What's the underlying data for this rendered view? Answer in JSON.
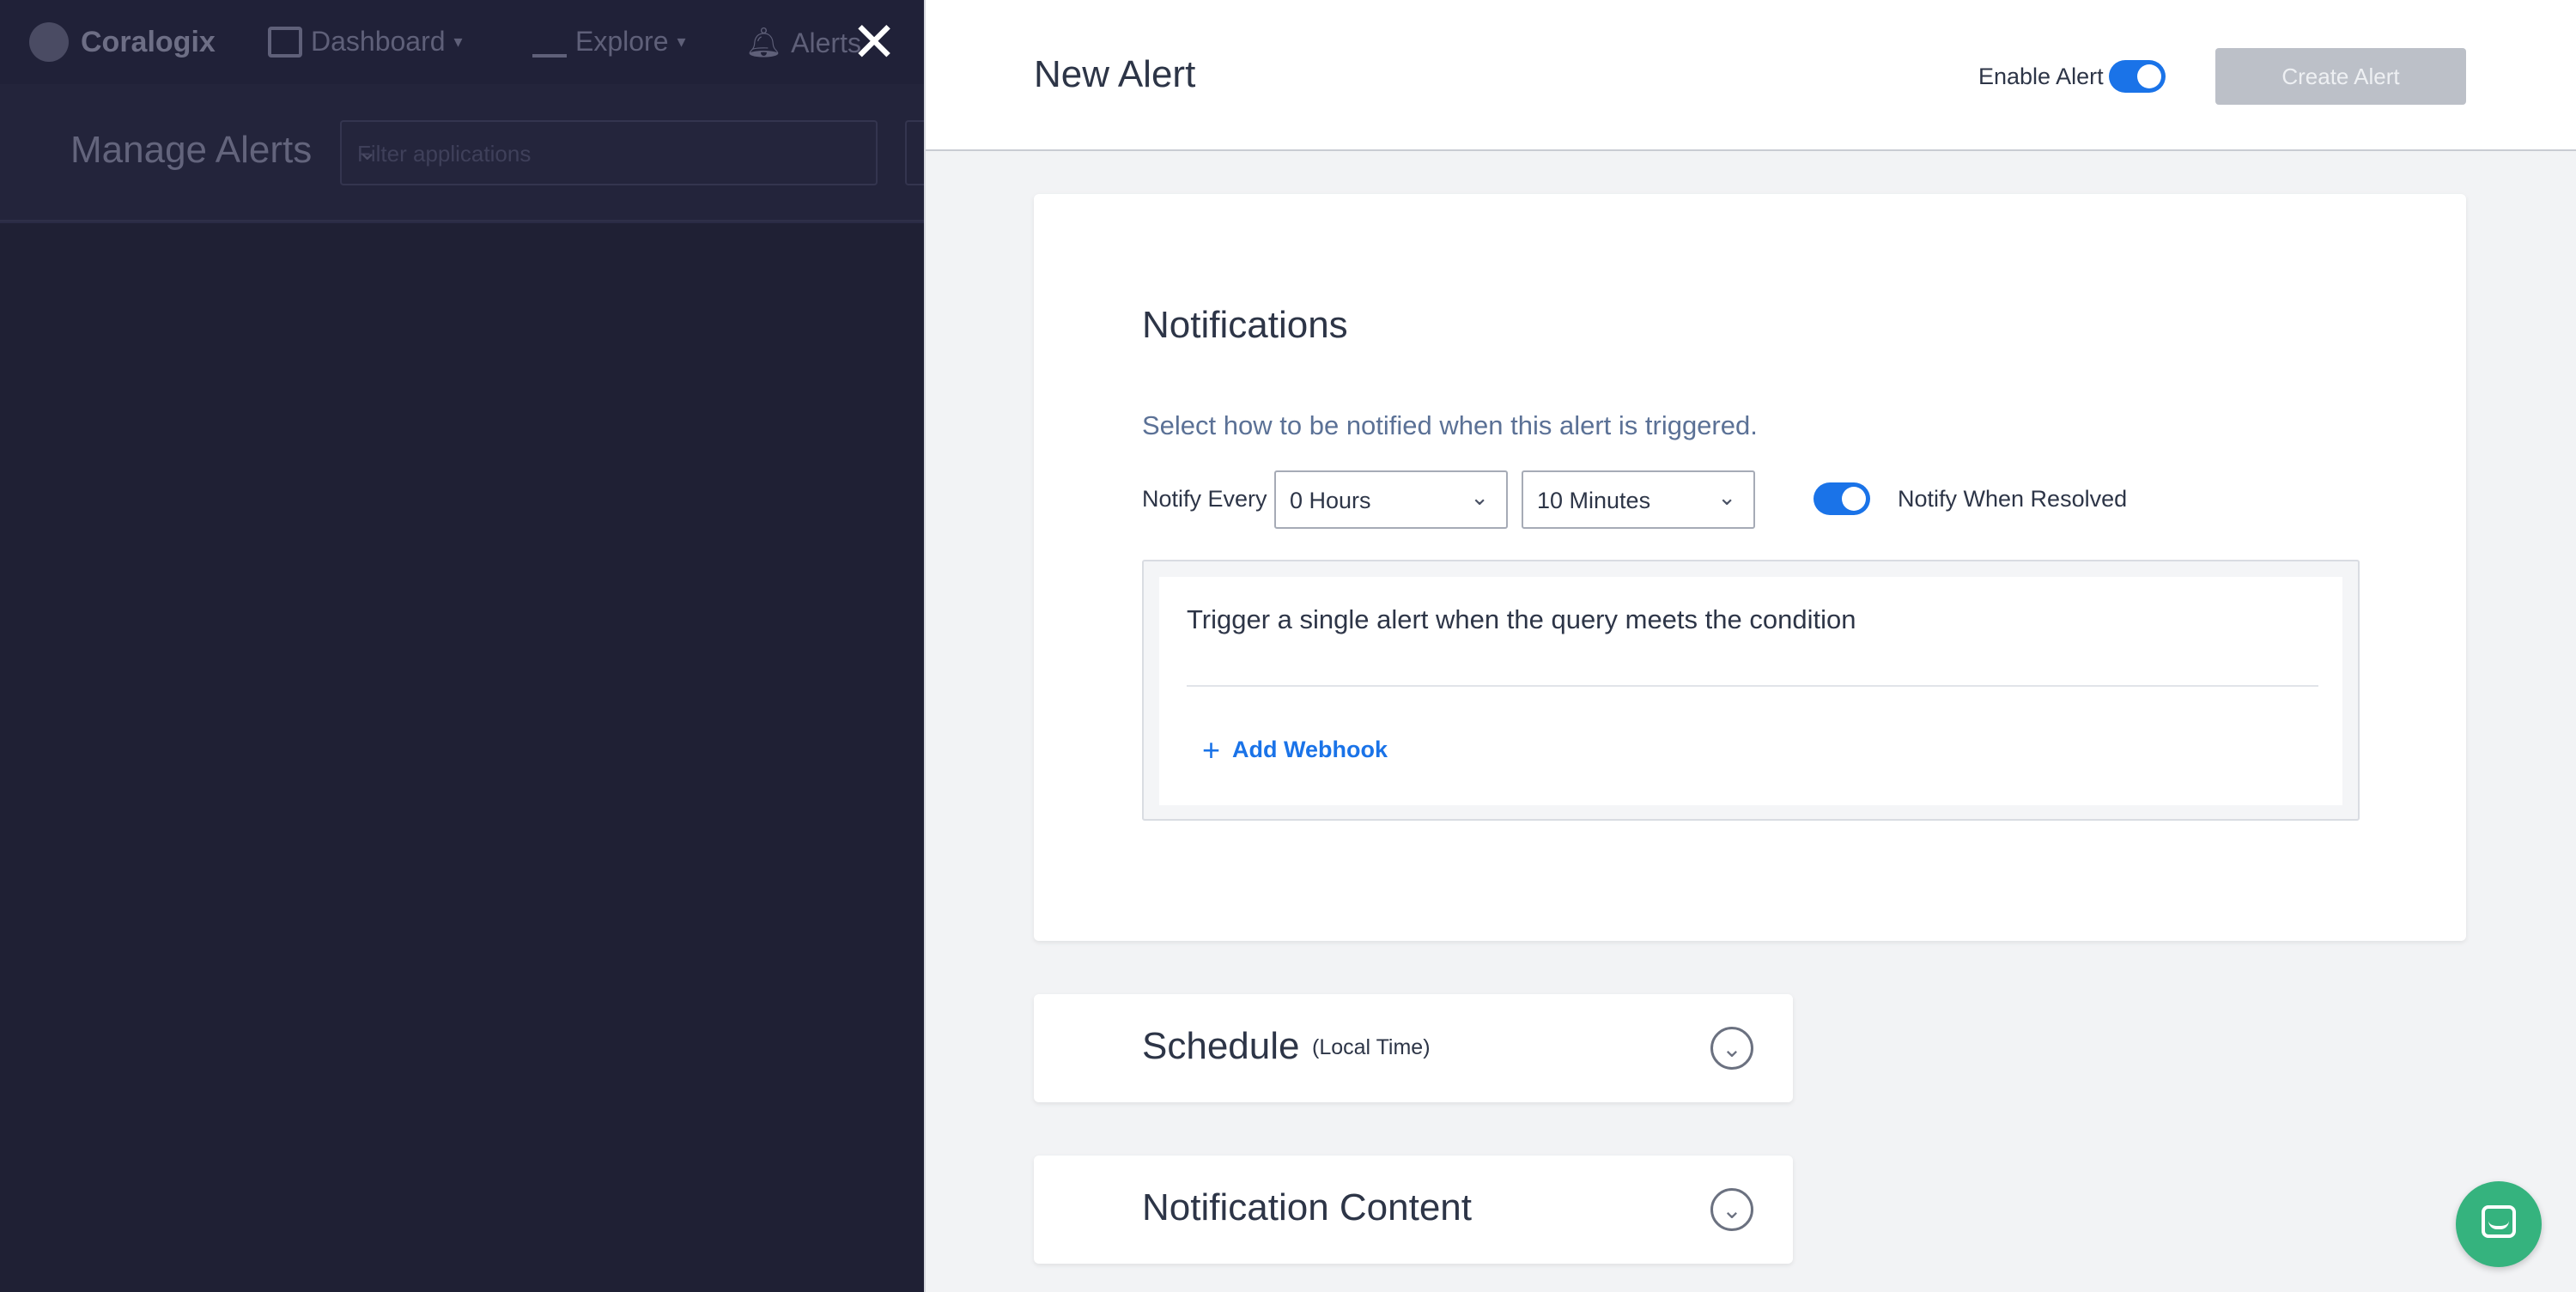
{
  "background": {
    "logo_text": "Coralogix",
    "nav": [
      {
        "label": "Dashboard",
        "icon": "grid-icon"
      },
      {
        "label": "Explore",
        "icon": "list-icon"
      },
      {
        "label": "Alerts",
        "icon": "bell-icon"
      }
    ],
    "page_title": "Manage Alerts",
    "filter_placeholder": "Filter applications"
  },
  "drawer": {
    "title": "New Alert",
    "enable_label": "Enable Alert",
    "enable_on": true,
    "create_label": "Create Alert"
  },
  "notifications": {
    "title": "Notifications",
    "subtitle": "Select how to be notified when this alert is triggered.",
    "notify_every_label": "Notify Every",
    "hours_value": "0 Hours",
    "minutes_value": "10 Minutes",
    "resolved_label": "Notify When Resolved",
    "resolved_on": true,
    "trigger_text": "Trigger a single alert when the query meets the condition",
    "add_webhook_label": "Add Webhook"
  },
  "schedule": {
    "title": "Schedule",
    "subtitle": "(Local Time)"
  },
  "notification_content": {
    "title": "Notification Content"
  },
  "colors": {
    "accent": "#1a73e8",
    "chat": "#35b37e",
    "overlay": "#1f2034"
  }
}
